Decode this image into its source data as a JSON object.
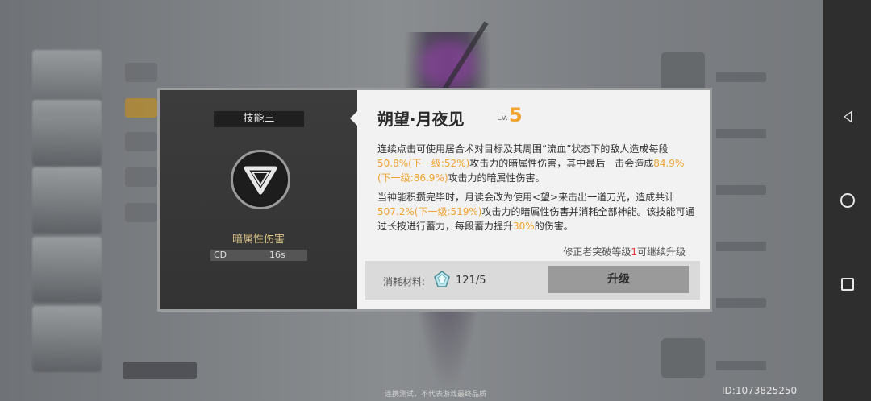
{
  "modal": {
    "skill_tab": "技能三",
    "damage_type": "暗属性伤害",
    "cd_label": "CD",
    "cd_value": "16s",
    "skill_name": "朔望·月夜见",
    "level_label": "Lv.",
    "level_value": "5",
    "desc1": {
      "a": "连续点击可使用居合术对目标及其周围“流血”状态下的敌人造成每段",
      "b": "50.8%(下一级:52%)",
      "c": "攻击力的暗属性伤害，其中最后一击会造成",
      "d": "84.9%(下一级:86.9%)",
      "e": "攻击力的暗属性伤害。"
    },
    "desc2": {
      "a": "当神能积攒完毕时，月读会改为使用<望>来击出一道刀光，造成共计",
      "b": "507.2%(下一级:519%)",
      "c": "攻击力的暗属性伤害并消耗全部神能。该技能可通过长按进行蓄力，每段蓄力提升",
      "d": "30%",
      "e": "的伤害。"
    },
    "upgrade_note": {
      "a": "修正者突破等级",
      "b": "1",
      "c": "可继续升级"
    },
    "cost_label": "消耗材料:",
    "cost_value": "121/5",
    "upgrade_button": "升级"
  },
  "footer": {
    "note": "连携测试，不代表游戏最终品质",
    "user_id": "ID:1073825250"
  },
  "colors": {
    "highlight": "#f2a330",
    "highlight_red": "#e23b3b"
  },
  "icons": [
    "skill-triangle-icon",
    "material-gem-icon",
    "nav-back-icon",
    "nav-home-icon",
    "nav-recent-icon"
  ]
}
